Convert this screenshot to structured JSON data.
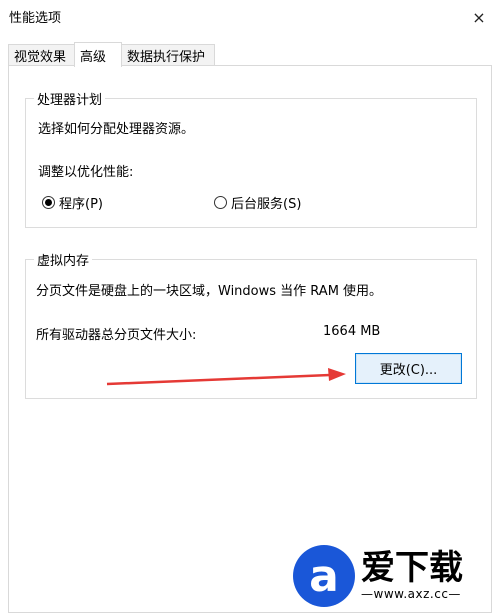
{
  "window": {
    "title": "性能选项",
    "close_icon": "×"
  },
  "tabs": [
    {
      "label": "视觉效果",
      "active": false
    },
    {
      "label": "高级",
      "active": true
    },
    {
      "label": "数据执行保护",
      "active": false
    }
  ],
  "processor_group": {
    "title": "处理器计划",
    "description": "选择如何分配处理器资源。",
    "adjust_label": "调整以优化性能:",
    "options": [
      {
        "label": "程序(P)",
        "selected": true
      },
      {
        "label": "后台服务(S)",
        "selected": false
      }
    ]
  },
  "vm_group": {
    "title": "虚拟内存",
    "description": "分页文件是硬盘上的一块区域，Windows 当作 RAM 使用。",
    "total_label": "所有驱动器总分页文件大小:",
    "total_value": "1664 MB",
    "change_button": "更改(C)..."
  },
  "annotation": {
    "arrow_color": "#e53935"
  },
  "watermark": {
    "logo_letter": "a",
    "brand": "爱下载",
    "url": "—www.axz.cc—",
    "color": "#1a57d8"
  }
}
